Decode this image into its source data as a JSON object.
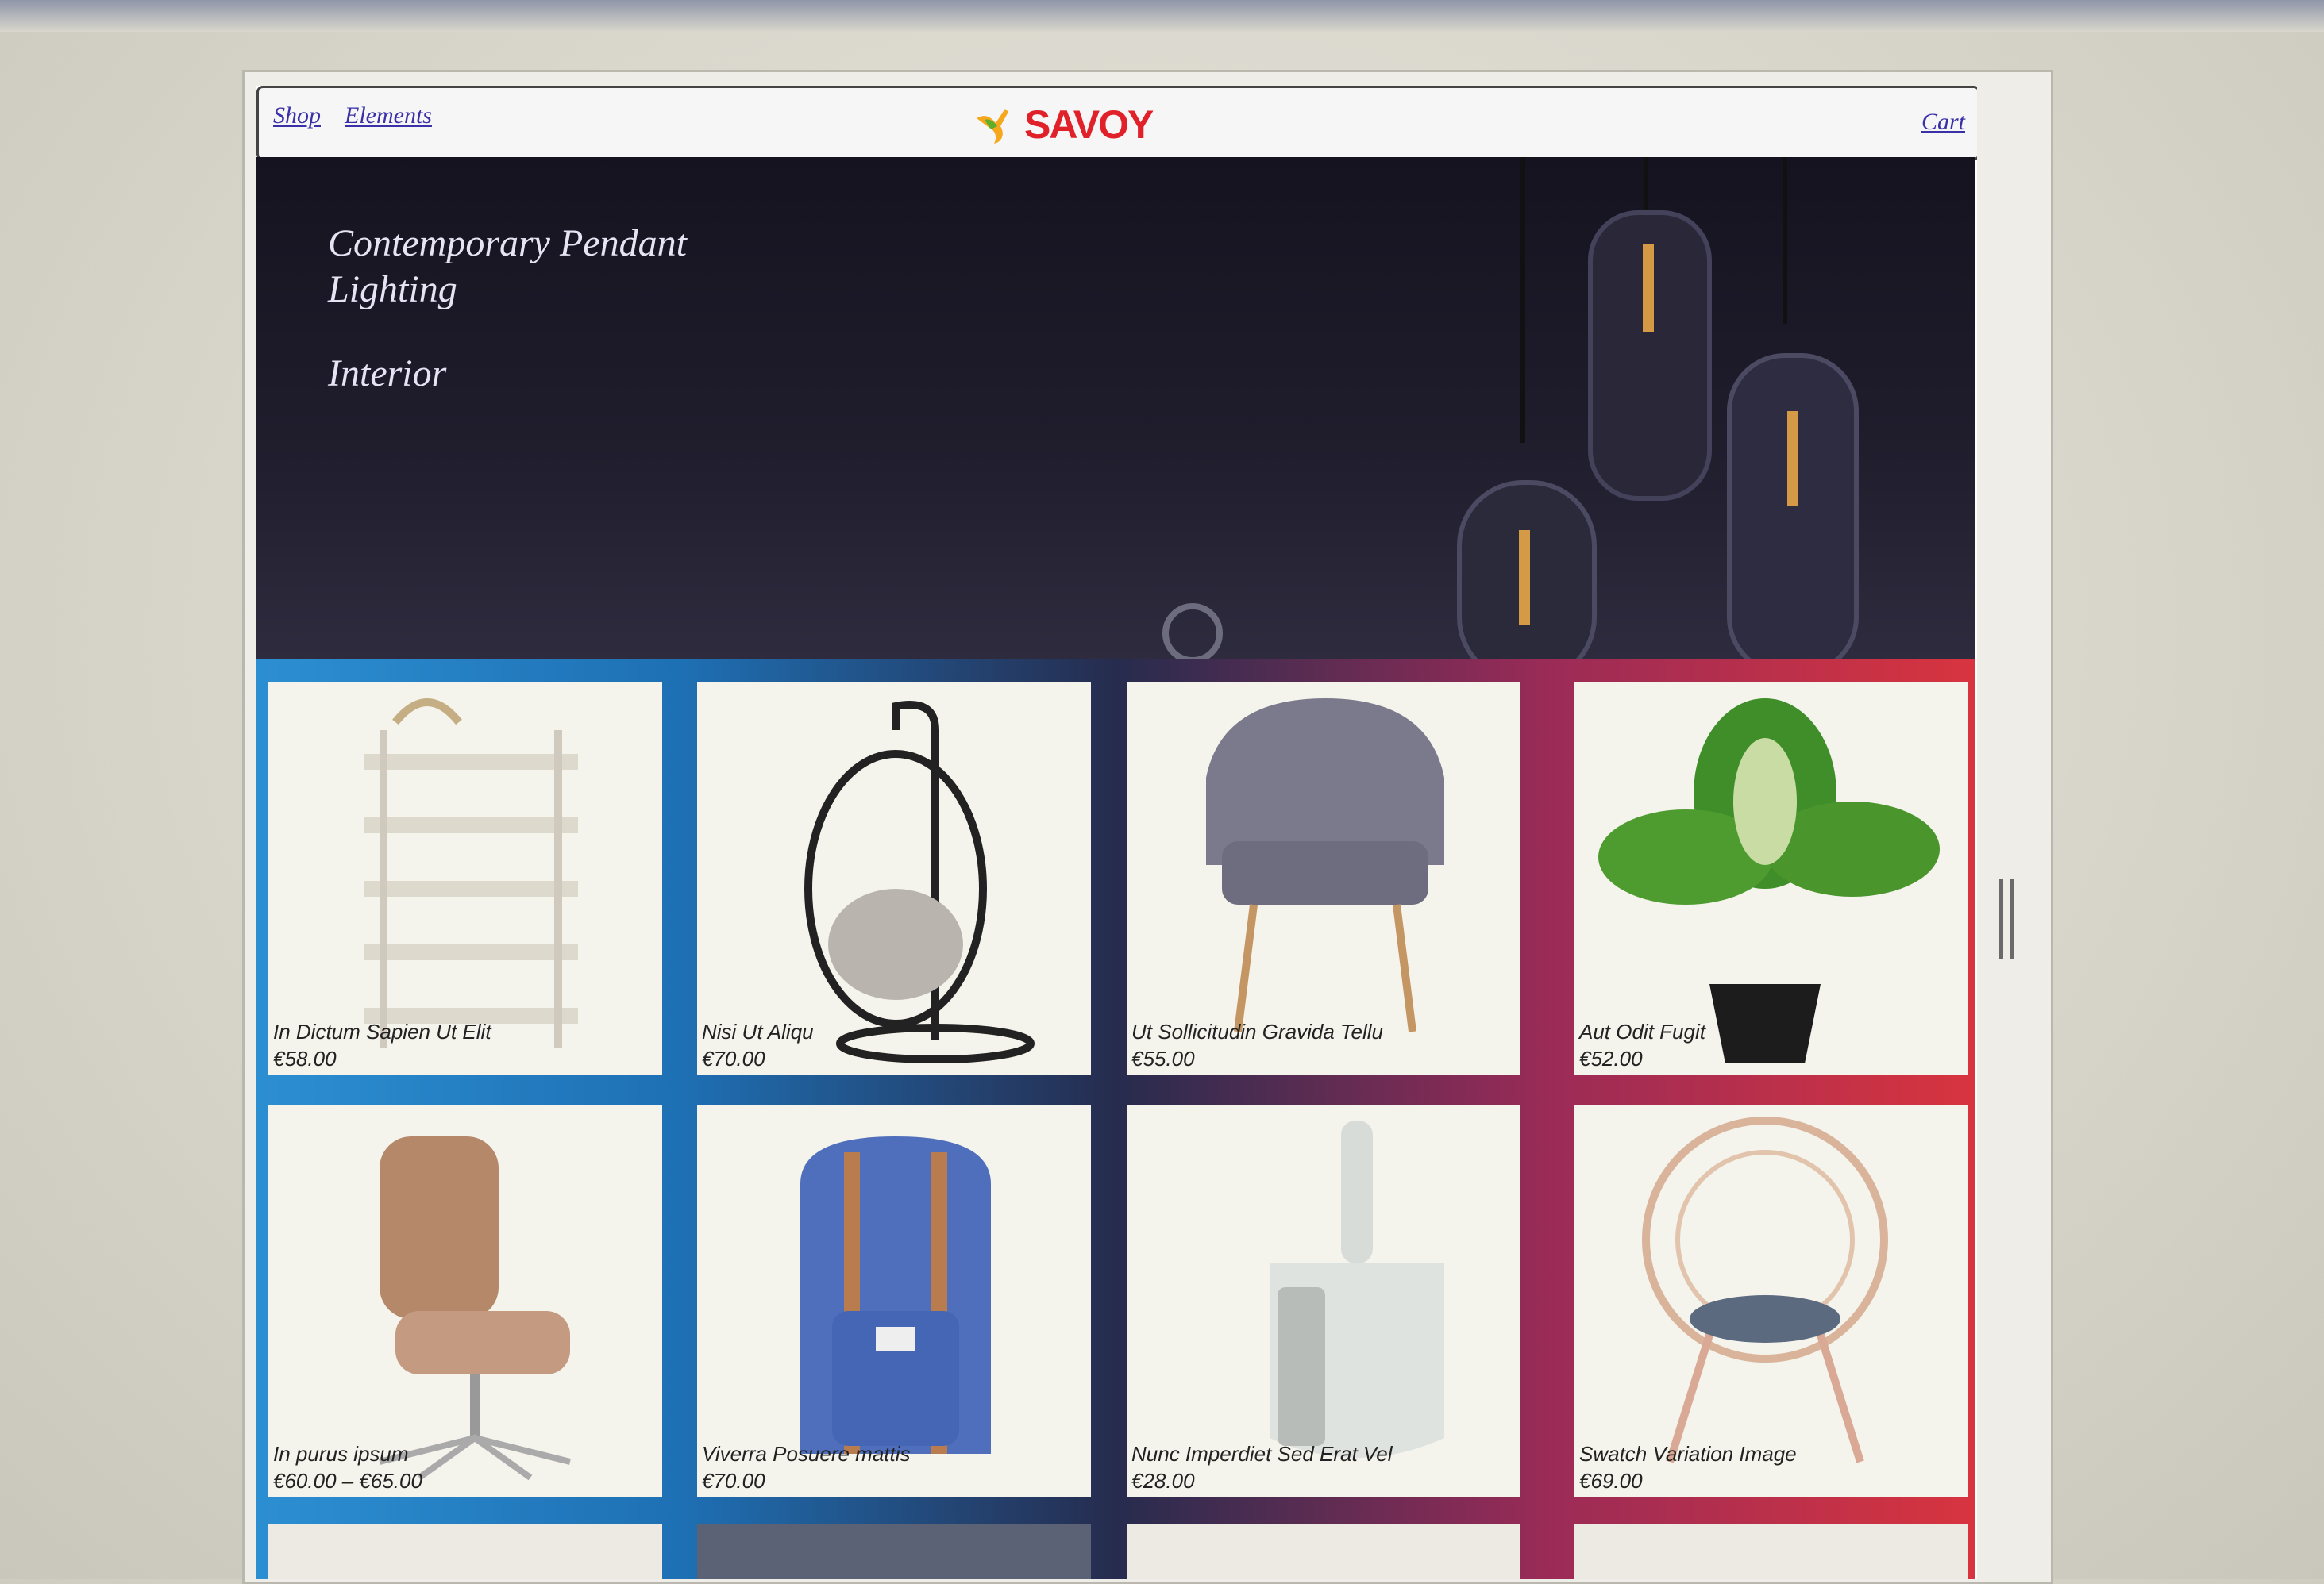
{
  "nav": {
    "shop": "Shop",
    "elements": "Elements",
    "logo": "SAVOY",
    "cart": "Cart"
  },
  "hero": {
    "title": "Contemporary Pendant Lighting",
    "subtitle": "Interior"
  },
  "products": [
    {
      "name": "In Dictum Sapien Ut Elit",
      "price": "€58.00"
    },
    {
      "name": "Nisi Ut Aliqu",
      "price": "€70.00"
    },
    {
      "name": "Ut Sollicitudin Gravida Tellu",
      "price": "€55.00"
    },
    {
      "name": "Aut Odit Fugit",
      "price": "€52.00"
    },
    {
      "name": "In purus ipsum",
      "price": "€60.00 – €65.00"
    },
    {
      "name": "Viverra Posuere mattis",
      "price": "€70.00"
    },
    {
      "name": "Nunc Imperdiet Sed Erat Vel",
      "price": "€28.00"
    },
    {
      "name": "Swatch Variation Image",
      "price": "€69.00"
    }
  ],
  "colors": {
    "brand_red": "#e0212a",
    "link": "#3a31a8",
    "hero_bg": "#1f1d2c"
  },
  "icons": [
    "hummingbird-logo-icon",
    "pendant-lamp-icon",
    "slider-dot-icon",
    "scrollbar-handle-icon"
  ]
}
